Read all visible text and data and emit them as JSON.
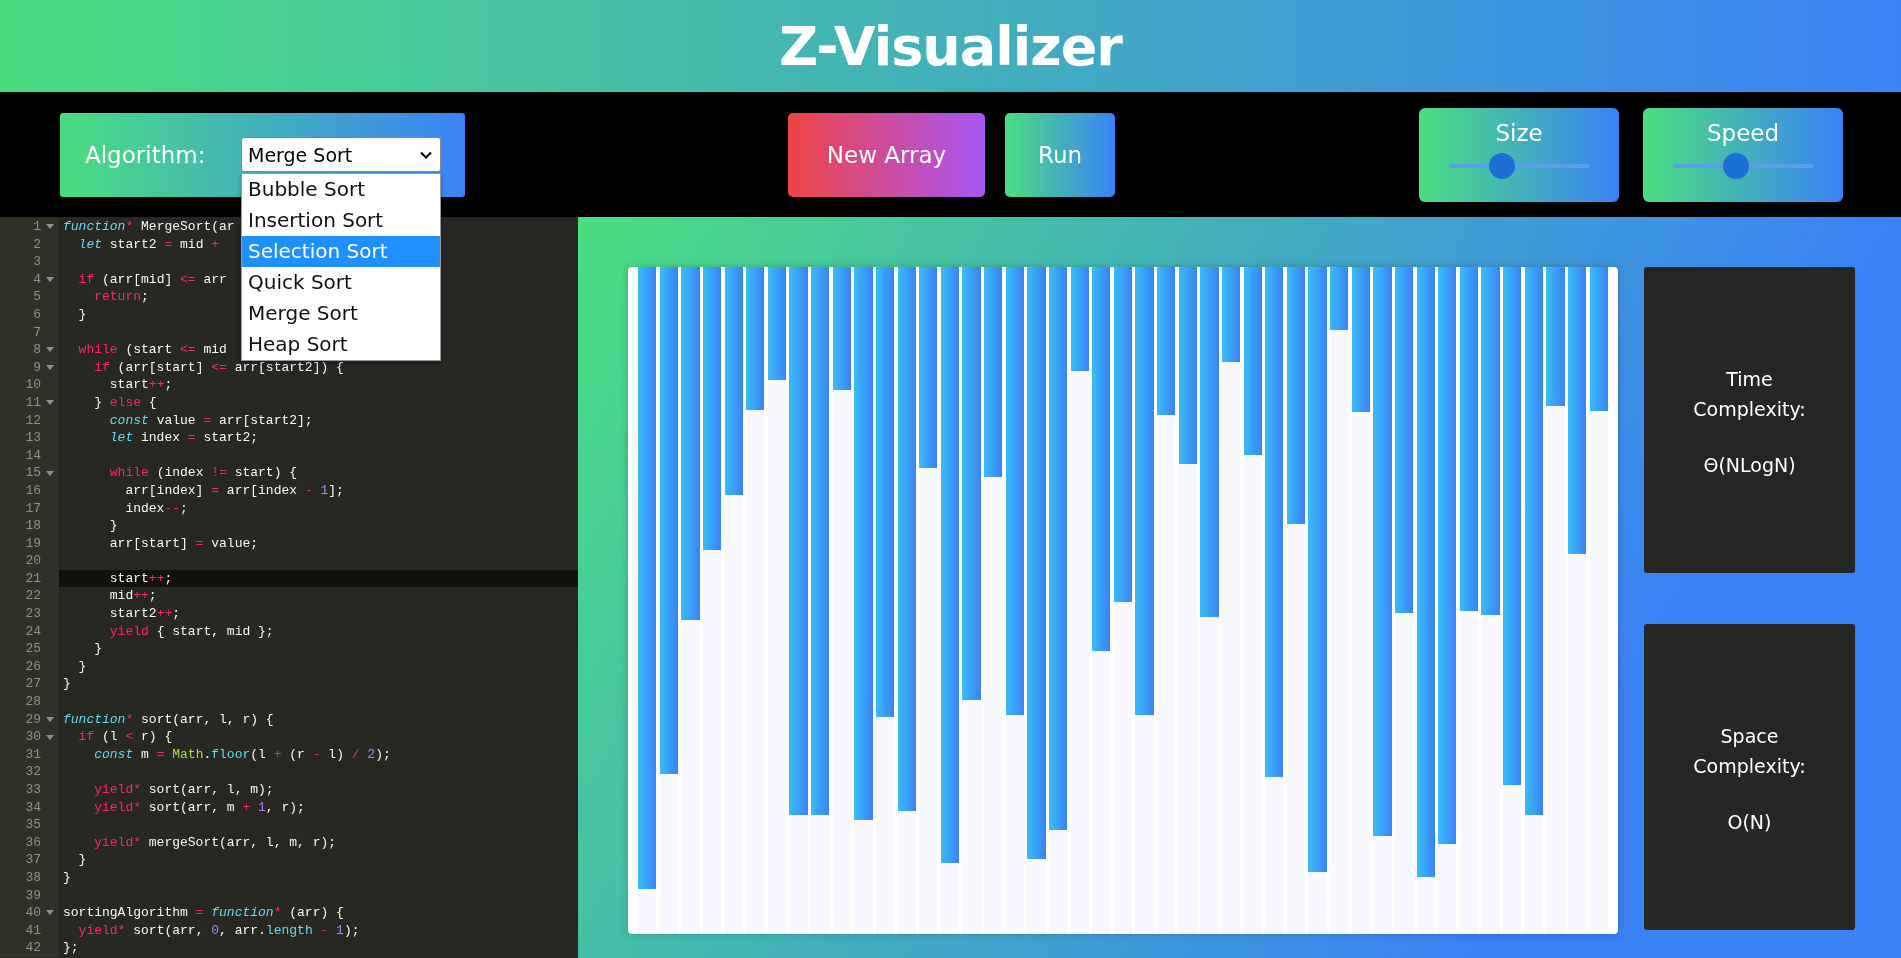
{
  "header": {
    "title": "Z-Visualizer"
  },
  "toolbar": {
    "algorithm_label": "Algorithm:",
    "algorithm_value": "Merge Sort",
    "algorithm_options": [
      {
        "label": "Bubble Sort",
        "selected": false
      },
      {
        "label": "Insertion Sort",
        "selected": false
      },
      {
        "label": "Selection Sort",
        "selected": true
      },
      {
        "label": "Quick Sort",
        "selected": false
      },
      {
        "label": "Merge Sort",
        "selected": false
      },
      {
        "label": "Heap Sort",
        "selected": false
      }
    ],
    "buttons": [
      {
        "label": "New Array",
        "kind": "danger"
      },
      {
        "label": "Run",
        "kind": "primary"
      }
    ],
    "sliders": [
      {
        "label": "Size",
        "level": 0.38
      },
      {
        "label": "Speed",
        "level": 0.45
      }
    ]
  },
  "code": [
    {
      "number": "1",
      "fold": true,
      "active": false,
      "tokens": [
        {
          "kind": "storage",
          "text": "function"
        },
        {
          "kind": "keyword",
          "text": "*"
        },
        {
          "kind": "plain",
          "text": " MergeSort(ar"
        }
      ]
    },
    {
      "number": "2",
      "fold": false,
      "active": false,
      "tokens": [
        {
          "kind": "storage",
          "text": "  let"
        },
        {
          "kind": "plain",
          "text": " start2 "
        },
        {
          "kind": "keyword",
          "text": "="
        },
        {
          "kind": "plain",
          "text": " mid "
        },
        {
          "kind": "keyword",
          "text": "+"
        }
      ]
    },
    {
      "number": "3",
      "fold": false,
      "active": false
    },
    {
      "number": "4",
      "fold": true,
      "active": false,
      "tokens": [
        {
          "kind": "keyword",
          "text": "  if"
        },
        {
          "kind": "plain",
          "text": " (arr[mid] "
        },
        {
          "kind": "keyword",
          "text": "<="
        },
        {
          "kind": "plain",
          "text": " arr"
        }
      ]
    },
    {
      "number": "5",
      "fold": false,
      "active": false,
      "tokens": [
        {
          "kind": "keyword",
          "text": "    return"
        },
        {
          "kind": "plain",
          "text": ";"
        }
      ]
    },
    {
      "number": "6",
      "fold": false,
      "active": false,
      "tokens": [
        {
          "kind": "plain",
          "text": "  }"
        }
      ]
    },
    {
      "number": "7",
      "fold": false,
      "active": false
    },
    {
      "number": "8",
      "fold": true,
      "active": false,
      "tokens": [
        {
          "kind": "keyword",
          "text": "  while"
        },
        {
          "kind": "plain",
          "text": " (start "
        },
        {
          "kind": "keyword",
          "text": "<="
        },
        {
          "kind": "plain",
          "text": " mid"
        }
      ]
    },
    {
      "number": "9",
      "fold": true,
      "active": false,
      "tokens": [
        {
          "kind": "keyword",
          "text": "    if"
        },
        {
          "kind": "plain",
          "text": " (arr[start] "
        },
        {
          "kind": "keyword",
          "text": "<="
        },
        {
          "kind": "plain",
          "text": " arr[start2]) {"
        }
      ]
    },
    {
      "number": "10",
      "fold": false,
      "active": false,
      "tokens": [
        {
          "kind": "plain",
          "text": "      start"
        },
        {
          "kind": "keyword",
          "text": "++"
        },
        {
          "kind": "plain",
          "text": ";"
        }
      ]
    },
    {
      "number": "11",
      "fold": true,
      "active": false,
      "tokens": [
        {
          "kind": "plain",
          "text": "    } "
        },
        {
          "kind": "keyword",
          "text": "else"
        },
        {
          "kind": "plain",
          "text": " {"
        }
      ]
    },
    {
      "number": "12",
      "fold": false,
      "active": false,
      "tokens": [
        {
          "kind": "storage",
          "text": "      const"
        },
        {
          "kind": "plain",
          "text": " value "
        },
        {
          "kind": "keyword",
          "text": "="
        },
        {
          "kind": "plain",
          "text": " arr[start2];"
        }
      ]
    },
    {
      "number": "13",
      "fold": false,
      "active": false,
      "tokens": [
        {
          "kind": "storage",
          "text": "      let"
        },
        {
          "kind": "plain",
          "text": " index "
        },
        {
          "kind": "keyword",
          "text": "="
        },
        {
          "kind": "plain",
          "text": " start2;"
        }
      ]
    },
    {
      "number": "14",
      "fold": false,
      "active": false
    },
    {
      "number": "15",
      "fold": true,
      "active": false,
      "tokens": [
        {
          "kind": "keyword",
          "text": "      while"
        },
        {
          "kind": "plain",
          "text": " (index "
        },
        {
          "kind": "keyword",
          "text": "!="
        },
        {
          "kind": "plain",
          "text": " start) {"
        }
      ]
    },
    {
      "number": "16",
      "fold": false,
      "active": false,
      "tokens": [
        {
          "kind": "plain",
          "text": "        arr[index] "
        },
        {
          "kind": "keyword",
          "text": "="
        },
        {
          "kind": "plain",
          "text": " arr[index "
        },
        {
          "kind": "keyword",
          "text": "-"
        },
        {
          "kind": "number",
          "text": " 1"
        },
        {
          "kind": "plain",
          "text": "];"
        }
      ]
    },
    {
      "number": "17",
      "fold": false,
      "active": false,
      "tokens": [
        {
          "kind": "plain",
          "text": "        index"
        },
        {
          "kind": "keyword",
          "text": "--"
        },
        {
          "kind": "plain",
          "text": ";"
        }
      ]
    },
    {
      "number": "18",
      "fold": false,
      "active": false,
      "tokens": [
        {
          "kind": "plain",
          "text": "      }"
        }
      ]
    },
    {
      "number": "19",
      "fold": false,
      "active": false,
      "tokens": [
        {
          "kind": "plain",
          "text": "      arr[start] "
        },
        {
          "kind": "keyword",
          "text": "="
        },
        {
          "kind": "plain",
          "text": " value;"
        }
      ]
    },
    {
      "number": "20",
      "fold": false,
      "active": false
    },
    {
      "number": "21",
      "fold": false,
      "active": true,
      "tokens": [
        {
          "kind": "plain",
          "text": "      start"
        },
        {
          "kind": "keyword",
          "text": "++"
        },
        {
          "kind": "plain",
          "text": ";"
        }
      ]
    },
    {
      "number": "22",
      "fold": false,
      "active": false,
      "tokens": [
        {
          "kind": "plain",
          "text": "      mid"
        },
        {
          "kind": "keyword",
          "text": "++"
        },
        {
          "kind": "plain",
          "text": ";"
        }
      ]
    },
    {
      "number": "23",
      "fold": false,
      "active": false,
      "tokens": [
        {
          "kind": "plain",
          "text": "      start2"
        },
        {
          "kind": "keyword",
          "text": "++"
        },
        {
          "kind": "plain",
          "text": ";"
        }
      ]
    },
    {
      "number": "24",
      "fold": false,
      "active": false,
      "tokens": [
        {
          "kind": "keyword",
          "text": "      yield"
        },
        {
          "kind": "plain",
          "text": " { start, mid };"
        }
      ]
    },
    {
      "number": "25",
      "fold": false,
      "active": false,
      "tokens": [
        {
          "kind": "plain",
          "text": "    }"
        }
      ]
    },
    {
      "number": "26",
      "fold": false,
      "active": false,
      "tokens": [
        {
          "kind": "plain",
          "text": "  }"
        }
      ]
    },
    {
      "number": "27",
      "fold": false,
      "active": false,
      "tokens": [
        {
          "kind": "plain",
          "text": "}"
        }
      ]
    },
    {
      "number": "28",
      "fold": false,
      "active": false
    },
    {
      "number": "29",
      "fold": true,
      "active": false,
      "tokens": [
        {
          "kind": "storage",
          "text": "function"
        },
        {
          "kind": "keyword",
          "text": "*"
        },
        {
          "kind": "plain",
          "text": " sort(arr, l, r) {"
        }
      ]
    },
    {
      "number": "30",
      "fold": true,
      "active": false,
      "tokens": [
        {
          "kind": "keyword",
          "text": "  if"
        },
        {
          "kind": "plain",
          "text": " (l "
        },
        {
          "kind": "keyword",
          "text": "<"
        },
        {
          "kind": "plain",
          "text": " r) {"
        }
      ]
    },
    {
      "number": "31",
      "fold": false,
      "active": false,
      "tokens": [
        {
          "kind": "storage",
          "text": "    const"
        },
        {
          "kind": "plain",
          "text": " m "
        },
        {
          "kind": "keyword",
          "text": "="
        },
        {
          "kind": "support",
          "text": " Math"
        },
        {
          "kind": "plain",
          "text": "."
        },
        {
          "kind": "method",
          "text": "floor"
        },
        {
          "kind": "plain",
          "text": "(l "
        },
        {
          "kind": "keyword",
          "text": "+"
        },
        {
          "kind": "plain",
          "text": " (r "
        },
        {
          "kind": "keyword",
          "text": "-"
        },
        {
          "kind": "plain",
          "text": " l) "
        },
        {
          "kind": "keyword",
          "text": "/"
        },
        {
          "kind": "number",
          "text": " 2"
        },
        {
          "kind": "plain",
          "text": ");"
        }
      ]
    },
    {
      "number": "32",
      "fold": false,
      "active": false
    },
    {
      "number": "33",
      "fold": false,
      "active": false,
      "tokens": [
        {
          "kind": "keyword",
          "text": "    yield*"
        },
        {
          "kind": "plain",
          "text": " sort(arr, l, m);"
        }
      ]
    },
    {
      "number": "34",
      "fold": false,
      "active": false,
      "tokens": [
        {
          "kind": "keyword",
          "text": "    yield*"
        },
        {
          "kind": "plain",
          "text": " sort(arr, m "
        },
        {
          "kind": "keyword",
          "text": "+"
        },
        {
          "kind": "number",
          "text": " 1"
        },
        {
          "kind": "plain",
          "text": ", r);"
        }
      ]
    },
    {
      "number": "35",
      "fold": false,
      "active": false
    },
    {
      "number": "36",
      "fold": false,
      "active": false,
      "tokens": [
        {
          "kind": "keyword",
          "text": "    yield*"
        },
        {
          "kind": "plain",
          "text": " mergeSort(arr, l, m, r);"
        }
      ]
    },
    {
      "number": "37",
      "fold": false,
      "active": false,
      "tokens": [
        {
          "kind": "plain",
          "text": "  }"
        }
      ]
    },
    {
      "number": "38",
      "fold": false,
      "active": false,
      "tokens": [
        {
          "kind": "plain",
          "text": "}"
        }
      ]
    },
    {
      "number": "39",
      "fold": false,
      "active": false
    },
    {
      "number": "40",
      "fold": true,
      "active": false,
      "tokens": [
        {
          "kind": "plain",
          "text": "sortingAlgorithm "
        },
        {
          "kind": "keyword",
          "text": "="
        },
        {
          "kind": "storage",
          "text": " function"
        },
        {
          "kind": "keyword",
          "text": "*"
        },
        {
          "kind": "plain",
          "text": " (arr) {"
        }
      ]
    },
    {
      "number": "41",
      "fold": false,
      "active": false,
      "tokens": [
        {
          "kind": "keyword",
          "text": "  yield*"
        },
        {
          "kind": "plain",
          "text": " sort(arr, "
        },
        {
          "kind": "number",
          "text": "0"
        },
        {
          "kind": "plain",
          "text": ", arr."
        },
        {
          "kind": "method",
          "text": "length"
        },
        {
          "kind": "keyword",
          "text": " -"
        },
        {
          "kind": "number",
          "text": " 1"
        },
        {
          "kind": "plain",
          "text": ");"
        }
      ]
    },
    {
      "number": "42",
      "fold": false,
      "active": false,
      "tokens": [
        {
          "kind": "plain",
          "text": "};"
        }
      ]
    }
  ],
  "bars": [
    {
      "level": 0.933
    },
    {
      "level": 0.76
    },
    {
      "level": 0.529
    },
    {
      "level": 0.425
    },
    {
      "level": 0.342
    },
    {
      "level": 0.215
    },
    {
      "level": 0.169
    },
    {
      "level": 0.822
    },
    {
      "level": 0.822
    },
    {
      "level": 0.184
    },
    {
      "level": 0.829
    },
    {
      "level": 0.675
    },
    {
      "level": 0.816
    },
    {
      "level": 0.302
    },
    {
      "level": 0.893
    },
    {
      "level": 0.649
    },
    {
      "level": 0.315
    },
    {
      "level": 0.671
    },
    {
      "level": 0.887
    },
    {
      "level": 0.844
    },
    {
      "level": 0.156
    },
    {
      "level": 0.575
    },
    {
      "level": 0.502
    },
    {
      "level": 0.671
    },
    {
      "level": 0.222
    },
    {
      "level": 0.296
    },
    {
      "level": 0.525
    },
    {
      "level": 0.142
    },
    {
      "level": 0.282
    },
    {
      "level": 0.764
    },
    {
      "level": 0.385
    },
    {
      "level": 0.907
    },
    {
      "level": 0.095
    },
    {
      "level": 0.218
    },
    {
      "level": 0.853
    },
    {
      "level": 0.518
    },
    {
      "level": 0.915
    },
    {
      "level": 0.865
    },
    {
      "level": 0.515
    },
    {
      "level": 0.522
    },
    {
      "level": 0.776
    },
    {
      "level": 0.822
    },
    {
      "level": 0.209
    },
    {
      "level": 0.431
    },
    {
      "level": 0.216
    }
  ],
  "complexity": [
    {
      "title": "Time Complexity:",
      "value": "Θ(NLogN)"
    },
    {
      "title": "Space Complexity:",
      "value": "O(N)"
    }
  ]
}
